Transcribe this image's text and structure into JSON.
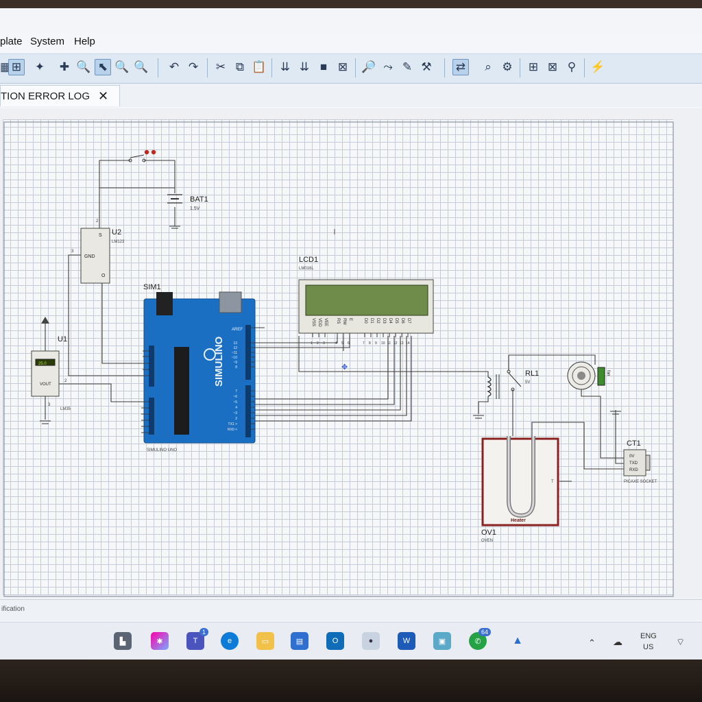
{
  "menu": {
    "items": [
      "plate",
      "System",
      "Help"
    ]
  },
  "tab": {
    "label": "TION ERROR LOG",
    "close": "✕"
  },
  "toolbar": {
    "icons": [
      "grid-icon",
      "origin-icon",
      "pan-icon",
      "zoom-in-icon",
      "zoom-select-icon",
      "zoom-out-icon",
      "zoom-fit-icon",
      "undo-icon",
      "redo-icon",
      "cut-icon",
      "copy-icon",
      "paste-icon",
      "block-copy-icon",
      "block-move-icon",
      "block-rotate-icon",
      "block-delete-icon",
      "pick-device-icon",
      "make-device-icon",
      "package-icon",
      "decompose-icon",
      "wire-autorouter-icon",
      "search-tag-icon",
      "property-tool-icon",
      "new-sheet-icon",
      "remove-sheet-icon",
      "netlist-icon",
      "bom-icon"
    ]
  },
  "schematic": {
    "battery": {
      "ref": "BAT1",
      "value": "1.5V"
    },
    "regulator": {
      "ref": "U2",
      "value": "LM123",
      "pin_s": "S",
      "pin_gnd": "GND",
      "pin_o": "O",
      "pin1": "2",
      "pin3": "3"
    },
    "sensor": {
      "ref": "U1",
      "value": "LM35",
      "pin_out": "VOUT",
      "display": "25.0",
      "pin": "2",
      "pin3": "3"
    },
    "arduino": {
      "ref": "SIM1",
      "value": "SIMULINO UNO",
      "brand": "SIMULINO",
      "aref": "AREF",
      "pins": [
        "13",
        "12",
        "~11",
        "~10",
        "~9",
        "8",
        "7",
        "~6",
        "~5",
        "4",
        "~3",
        "2",
        "TX1 >",
        "RX0 <"
      ]
    },
    "lcd": {
      "ref": "LCD1",
      "value": "LM016L",
      "pins": [
        "VSS",
        "VDD",
        "VEE",
        "RS",
        "RW",
        "E",
        "D0",
        "D1",
        "D2",
        "D3",
        "D4",
        "D5",
        "D6",
        "D7"
      ],
      "nums": [
        "1",
        "2",
        "3",
        "4",
        "5",
        "6",
        "7",
        "8",
        "9",
        "10",
        "11",
        "12",
        "13",
        "14"
      ]
    },
    "relay": {
      "ref": "RL1",
      "value": "5V"
    },
    "motor": {
      "label": "fan"
    },
    "oven": {
      "ref": "OV1",
      "value": "OVEN",
      "heater": "Heater",
      "t": "T"
    },
    "ct": {
      "ref": "CT1",
      "value": "PICAXE SOCKET",
      "pins": [
        "0V",
        "TXD",
        "RXD"
      ]
    }
  },
  "status": {
    "text": "ification"
  },
  "tray": {
    "lang": "ENG",
    "region": "US"
  },
  "taskbar": {
    "badge_teams": "1",
    "badge_whatsapp": "64"
  }
}
